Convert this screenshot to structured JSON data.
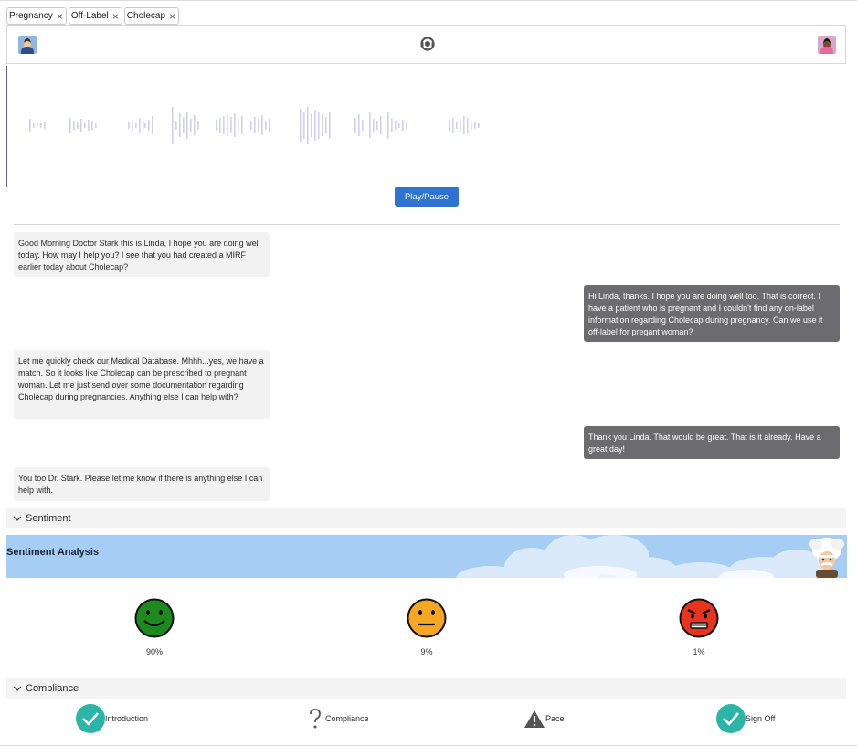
{
  "tags": [
    {
      "label": "Pregnancy"
    },
    {
      "label": "Off-Label"
    },
    {
      "label": "Cholecap"
    }
  ],
  "player": {
    "play_label": "Play/Pause"
  },
  "messages": [
    {
      "side": "in",
      "text": "Good Morning Doctor Stark this is Linda, I hope you are doing well today. How may I help you? I see that you had created a MIRF earlier today about Cholecap?"
    },
    {
      "side": "out",
      "text": "Hi Linda, thanks. I hope you are doing well too. That is correct. I have a patient who is pregnant and I couldn't find any on-label information regarding Cholecap during pregnancy. Can we use it off-label for pregant woman?"
    },
    {
      "side": "in",
      "text": "Let me quickly check our Medical Database. Mhhh...yes, we have a match. So it looks like Cholecap can be prescribed to pregnant woman. Let me just send over some documentation regarding Cholecap during pregnancies. Anything else I can help with?"
    },
    {
      "side": "out",
      "text": "Thank you Linda. That would be great. That is it already. Have a great day!"
    },
    {
      "side": "in",
      "text": "You too Dr. Stark. Please let me know if there is anything else I can help with."
    }
  ],
  "sentiment": {
    "section_label": "Sentiment",
    "banner_title": "Sentiment Analysis",
    "positive": {
      "value": "90%",
      "color": "#1e8a1e"
    },
    "neutral": {
      "value": "9%",
      "color": "#f5a623"
    },
    "negative": {
      "value": "1%",
      "color": "#e8331f"
    }
  },
  "compliance": {
    "section_label": "Compliance",
    "items": [
      {
        "label": "Introduction",
        "status": "check-icon"
      },
      {
        "label": "Compliance",
        "status": "question-icon"
      },
      {
        "label": "Pace",
        "status": "warning-icon"
      },
      {
        "label": "Sign Off",
        "status": "check-icon"
      }
    ]
  },
  "colors": {
    "accent": "#2f73d2",
    "outgoing_bubble": "#6b6b70",
    "incoming_bubble": "#f2f2f2",
    "check": "#2bb5a7",
    "banner": "#a6cef5"
  }
}
